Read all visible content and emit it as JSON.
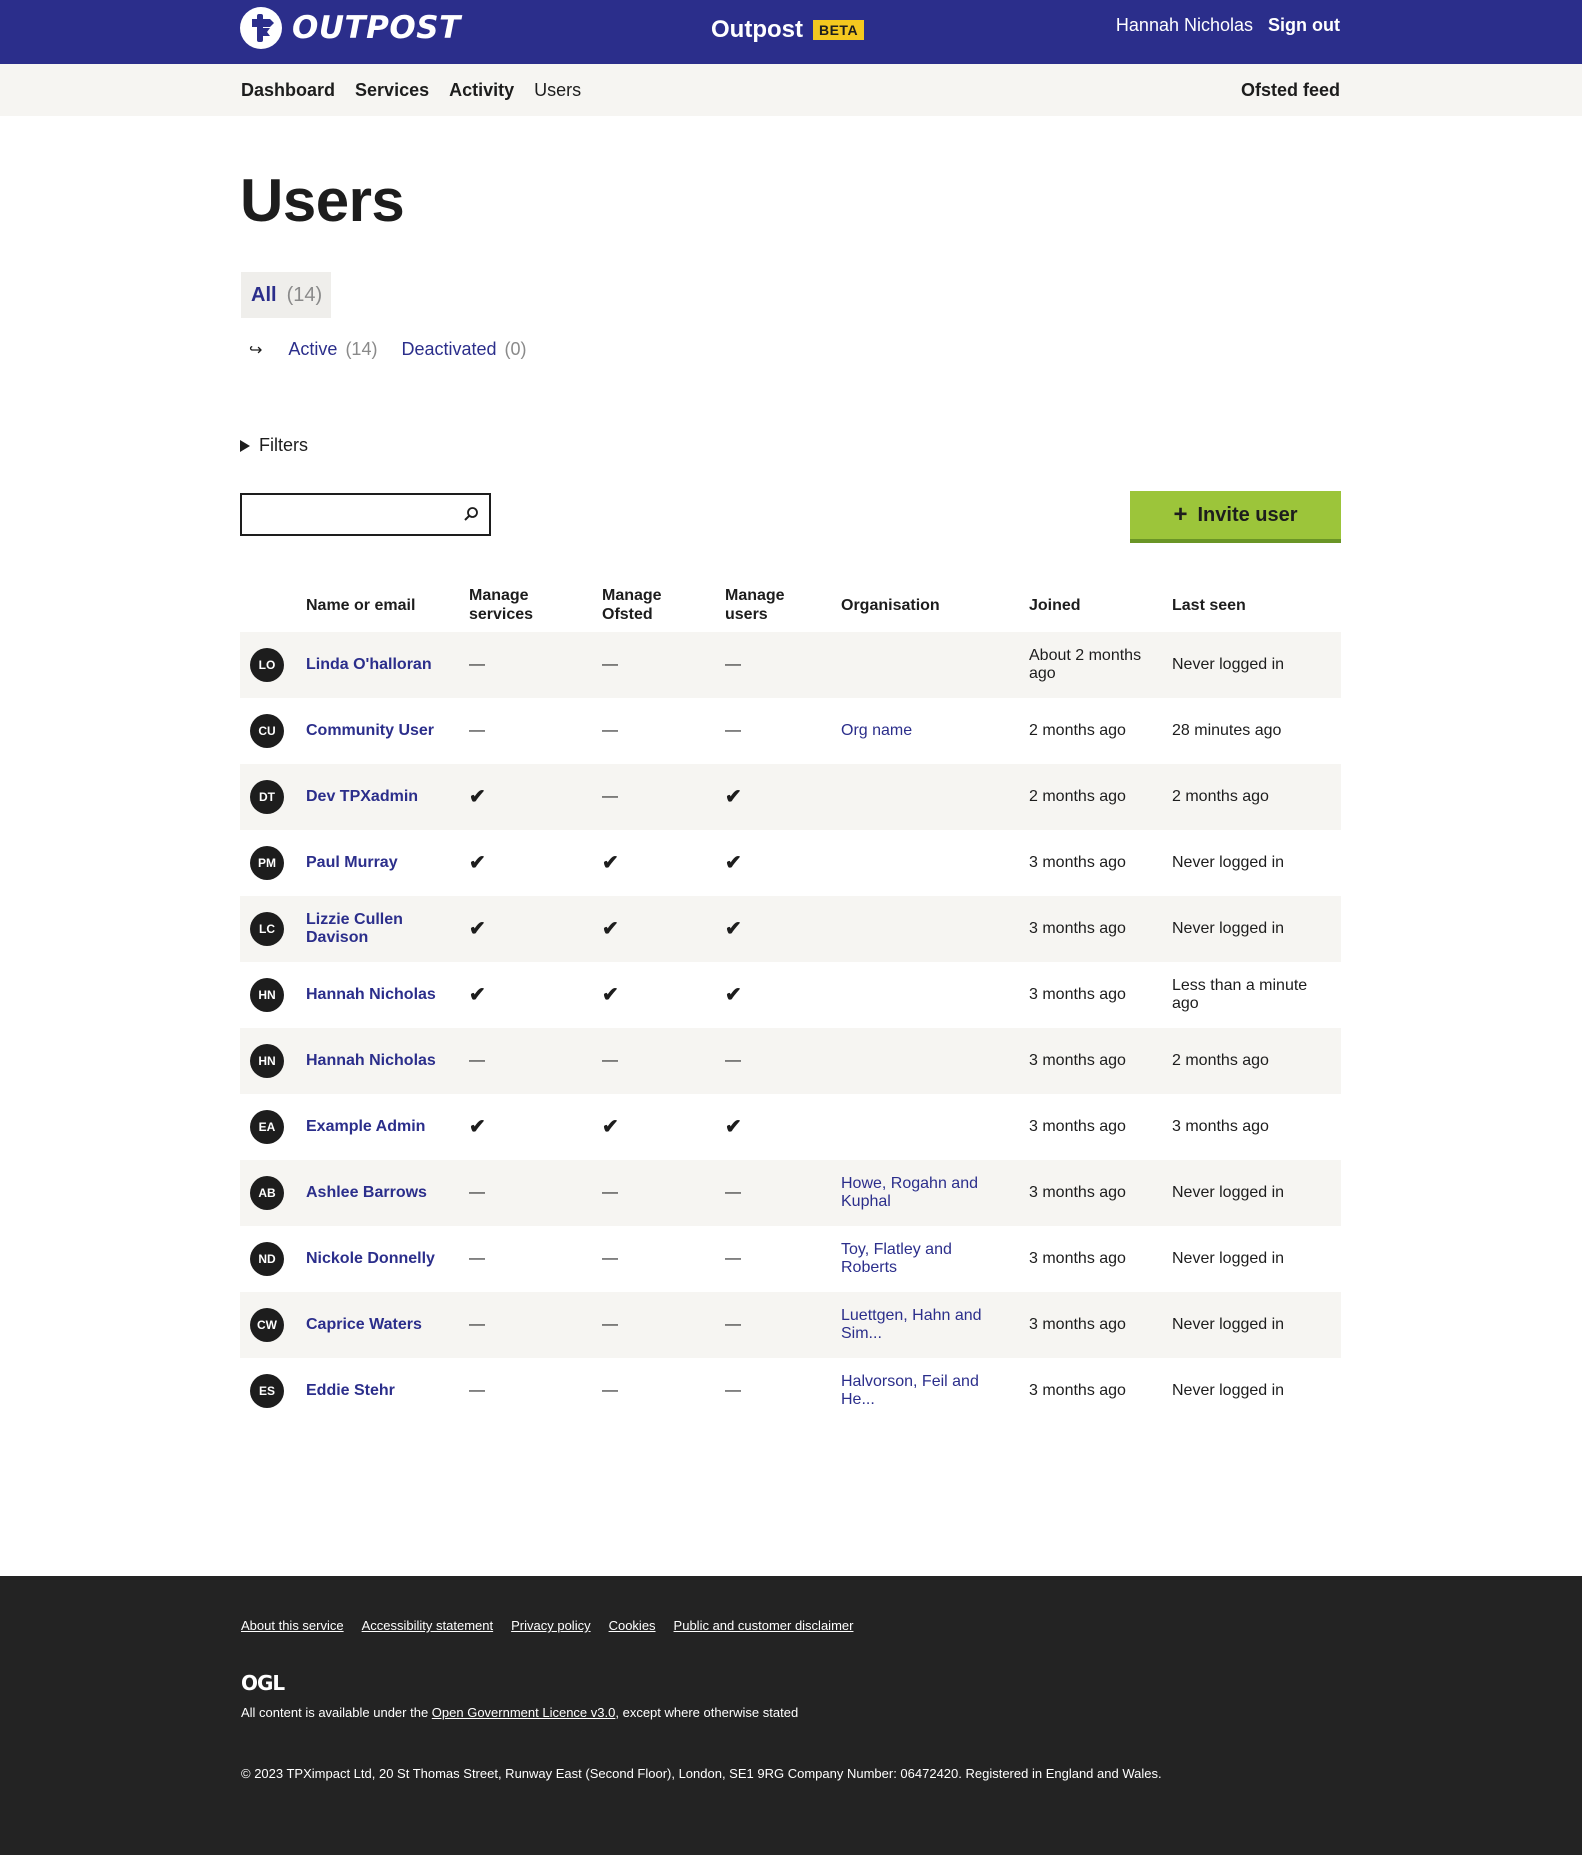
{
  "header": {
    "logo_text": "OUTPOST",
    "service_name": "Outpost",
    "beta_label": "BETA",
    "user_name": "Hannah Nicholas",
    "sign_out": "Sign out"
  },
  "nav": {
    "items": [
      {
        "label": "Dashboard"
      },
      {
        "label": "Services"
      },
      {
        "label": "Activity"
      },
      {
        "label": "Users"
      }
    ],
    "right_link": "Ofsted feed"
  },
  "page": {
    "title": "Users",
    "tab_all": {
      "label": "All",
      "count": "(14)"
    },
    "subtabs": [
      {
        "label": "Active",
        "count": "(14)"
      },
      {
        "label": "Deactivated",
        "count": "(0)"
      }
    ],
    "filters_label": "Filters",
    "search": {
      "placeholder": "",
      "value": ""
    },
    "invite_button": "Invite user"
  },
  "table": {
    "headers": {
      "name": "Name or email",
      "services_1": "Manage",
      "services_2": "services",
      "ofsted_1": "Manage",
      "ofsted_2": "Ofsted",
      "users_1": "Manage",
      "users_2": "users",
      "organisation": "Organisation",
      "joined": "Joined",
      "last_seen": "Last seen"
    },
    "rows": [
      {
        "initials": "LO",
        "name": "Linda O'halloran",
        "services": "—",
        "ofsted": "—",
        "users": "—",
        "org": "",
        "joined": "About 2 months ago",
        "last_seen": "Never logged in"
      },
      {
        "initials": "CU",
        "name": "Community User",
        "services": "—",
        "ofsted": "—",
        "users": "—",
        "org": "Org name",
        "joined": "2 months ago",
        "last_seen": "28 minutes ago"
      },
      {
        "initials": "DT",
        "name": "Dev TPXadmin",
        "services": "✔",
        "ofsted": "—",
        "users": "✔",
        "org": "",
        "joined": "2 months ago",
        "last_seen": "2 months ago"
      },
      {
        "initials": "PM",
        "name": "Paul Murray",
        "services": "✔",
        "ofsted": "✔",
        "users": "✔",
        "org": "",
        "joined": "3 months ago",
        "last_seen": "Never logged in"
      },
      {
        "initials": "LC",
        "name": "Lizzie Cullen Davison",
        "services": "✔",
        "ofsted": "✔",
        "users": "✔",
        "org": "",
        "joined": "3 months ago",
        "last_seen": "Never logged in"
      },
      {
        "initials": "HN",
        "name": "Hannah Nicholas",
        "services": "✔",
        "ofsted": "✔",
        "users": "✔",
        "org": "",
        "joined": "3 months ago",
        "last_seen": "Less than a minute ago"
      },
      {
        "initials": "HN",
        "name": "Hannah Nicholas",
        "services": "—",
        "ofsted": "—",
        "users": "—",
        "org": "",
        "joined": "3 months ago",
        "last_seen": "2 months ago"
      },
      {
        "initials": "EA",
        "name": "Example Admin",
        "services": "✔",
        "ofsted": "✔",
        "users": "✔",
        "org": "",
        "joined": "3 months ago",
        "last_seen": "3 months ago"
      },
      {
        "initials": "AB",
        "name": "Ashlee Barrows",
        "services": "—",
        "ofsted": "—",
        "users": "—",
        "org": "Howe, Rogahn and Kuphal",
        "joined": "3 months ago",
        "last_seen": "Never logged in"
      },
      {
        "initials": "ND",
        "name": "Nickole Donnelly",
        "services": "—",
        "ofsted": "—",
        "users": "—",
        "org": "Toy, Flatley and Roberts",
        "joined": "3 months ago",
        "last_seen": "Never logged in"
      },
      {
        "initials": "CW",
        "name": "Caprice Waters",
        "services": "—",
        "ofsted": "—",
        "users": "—",
        "org": "Luettgen, Hahn and Sim...",
        "joined": "3 months ago",
        "last_seen": "Never logged in"
      },
      {
        "initials": "ES",
        "name": "Eddie Stehr",
        "services": "—",
        "ofsted": "—",
        "users": "—",
        "org": "Halvorson, Feil and He...",
        "joined": "3 months ago",
        "last_seen": "Never logged in"
      }
    ]
  },
  "footer": {
    "links": [
      {
        "label": "About this service"
      },
      {
        "label": "Accessibility statement"
      },
      {
        "label": "Privacy policy"
      },
      {
        "label": "Cookies"
      },
      {
        "label": "Public and customer disclaimer"
      }
    ],
    "ogl_logo": "OGL",
    "licence_prefix": "All content is available under the ",
    "licence_link": "Open Government Licence v3.0",
    "licence_suffix": ", except where otherwise stated",
    "copyright": "© 2023 TPXimpact Ltd, 20 St Thomas Street, Runway East (Second Floor), London, SE1 9RG Company Number: 06472420. Registered in England and Wales."
  },
  "colors": {
    "brand": "#2b2e8b",
    "beta": "#f4c81f",
    "invite_button": "#9cc53a",
    "row_shade": "#f6f5f2",
    "footer": "#232323"
  },
  "icons": {
    "logo": "outpost-signpost-icon",
    "search": "search-icon",
    "filters": "disclosure-triangle-icon",
    "subtab_arrow": "return-arrow-icon",
    "invite": "plus-icon",
    "tick": "checkmark-icon"
  }
}
